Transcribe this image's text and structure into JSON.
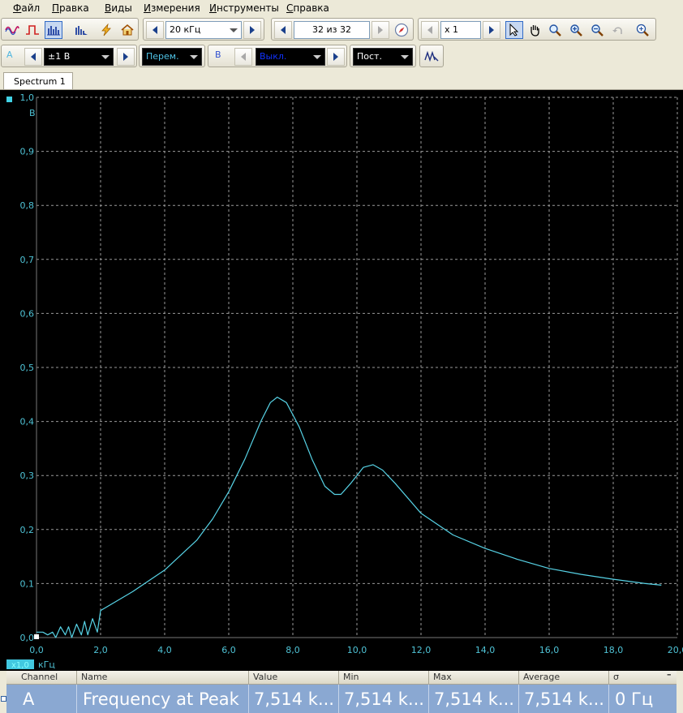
{
  "menu": [
    "Файл",
    "Правка",
    "Виды",
    "Измерения",
    "Инструменты",
    "Справка"
  ],
  "toolbar": {
    "timebase": "20 кГц",
    "capture_counter": "32 из 32",
    "zoom_factor": "x 1"
  },
  "channels": {
    "a_label": "A",
    "a_range": "±1 В",
    "a_coupling": "Перем.",
    "b_label": "B",
    "b_range": "Выкл.",
    "b_coupling": "Пост."
  },
  "tab": {
    "label": "Spectrum 1"
  },
  "colors": {
    "trace": "#57d3e6",
    "axis_text": "#4fc3d6",
    "grid": "#9a9a9a",
    "selection": "#8aa8d2"
  },
  "chart_data": {
    "type": "line",
    "xlabel": "кГц",
    "ylabel": "В",
    "x_marker": "x1,0",
    "xlim": [
      0,
      20
    ],
    "ylim": [
      0,
      1
    ],
    "xticks": [
      "0,0",
      "2,0",
      "4,0",
      "6,0",
      "8,0",
      "10,0",
      "12,0",
      "14,0",
      "16,0",
      "18,0",
      "20,0"
    ],
    "yticks": [
      "0,0",
      "0,1",
      "0,2",
      "0,3",
      "0,4",
      "0,5",
      "0,6",
      "0,7",
      "0,8",
      "0,9",
      "1,0"
    ],
    "grid": true,
    "series": [
      {
        "x": [
          0.0,
          0.2,
          0.35,
          0.5,
          0.6,
          0.75,
          0.9,
          1.0,
          1.1,
          1.25,
          1.4,
          1.5,
          1.6,
          1.75,
          1.9,
          2.0,
          3.0,
          4.0,
          5.0,
          5.5,
          6.0,
          6.5,
          7.0,
          7.3,
          7.514,
          7.8,
          8.2,
          8.6,
          9.0,
          9.3,
          9.5,
          9.8,
          10.2,
          10.5,
          10.8,
          11.2,
          12.0,
          13.0,
          14.0,
          15.0,
          16.0,
          17.0,
          18.0,
          19.0,
          19.5
        ],
        "y": [
          0.01,
          0.01,
          0.005,
          0.01,
          0.0,
          0.02,
          0.005,
          0.02,
          0.0,
          0.025,
          0.005,
          0.03,
          0.005,
          0.035,
          0.01,
          0.05,
          0.085,
          0.125,
          0.18,
          0.22,
          0.27,
          0.33,
          0.4,
          0.435,
          0.445,
          0.435,
          0.39,
          0.33,
          0.28,
          0.265,
          0.265,
          0.285,
          0.315,
          0.32,
          0.31,
          0.285,
          0.23,
          0.19,
          0.165,
          0.145,
          0.128,
          0.117,
          0.108,
          0.1,
          0.097
        ]
      }
    ]
  },
  "measurements": {
    "columns": [
      "Channel",
      "Name",
      "Value",
      "Min",
      "Max",
      "Average",
      "σ"
    ],
    "row": [
      "A",
      "Frequency at Peak",
      "7,514 k...",
      "7,514 k...",
      "7,514 k...",
      "7,514 k...",
      "0 Гц"
    ]
  }
}
